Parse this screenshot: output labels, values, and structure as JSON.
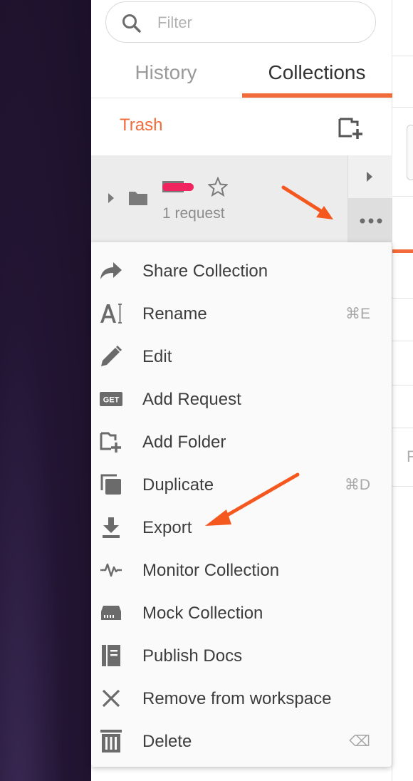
{
  "colors": {
    "accent": "#f26b3a",
    "annotation_arrow": "#f5581f",
    "redaction": "#f0245f"
  },
  "search": {
    "placeholder": "Filter",
    "icon": "search-icon"
  },
  "tabs": [
    {
      "label": "History",
      "active": false
    },
    {
      "label": "Collections",
      "active": true
    }
  ],
  "toolbar": {
    "trash_label": "Trash",
    "new_collection_icon": "new-collection-icon"
  },
  "collection": {
    "name_redacted": true,
    "request_count": "1 request"
  },
  "context_menu": {
    "items": [
      {
        "label": "Share Collection",
        "icon": "share-arrow-icon",
        "shortcut": ""
      },
      {
        "label": "Rename",
        "icon": "rename-icon",
        "shortcut": "⌘E"
      },
      {
        "label": "Edit",
        "icon": "pencil-icon",
        "shortcut": ""
      },
      {
        "label": "Add Request",
        "icon": "get-request-icon",
        "shortcut": ""
      },
      {
        "label": "Add Folder",
        "icon": "add-folder-icon",
        "shortcut": ""
      },
      {
        "label": "Duplicate",
        "icon": "duplicate-icon",
        "shortcut": "⌘D"
      },
      {
        "label": "Export",
        "icon": "download-icon",
        "shortcut": ""
      },
      {
        "label": "Monitor Collection",
        "icon": "monitor-pulse-icon",
        "shortcut": ""
      },
      {
        "label": "Mock Collection",
        "icon": "server-icon",
        "shortcut": ""
      },
      {
        "label": "Publish Docs",
        "icon": "docs-icon",
        "shortcut": ""
      },
      {
        "label": "Remove from workspace",
        "icon": "close-icon",
        "shortcut": ""
      },
      {
        "label": "Delete",
        "icon": "trash-icon",
        "shortcut": "⌫"
      }
    ]
  },
  "right_panel": {
    "partial_letter": "F"
  }
}
